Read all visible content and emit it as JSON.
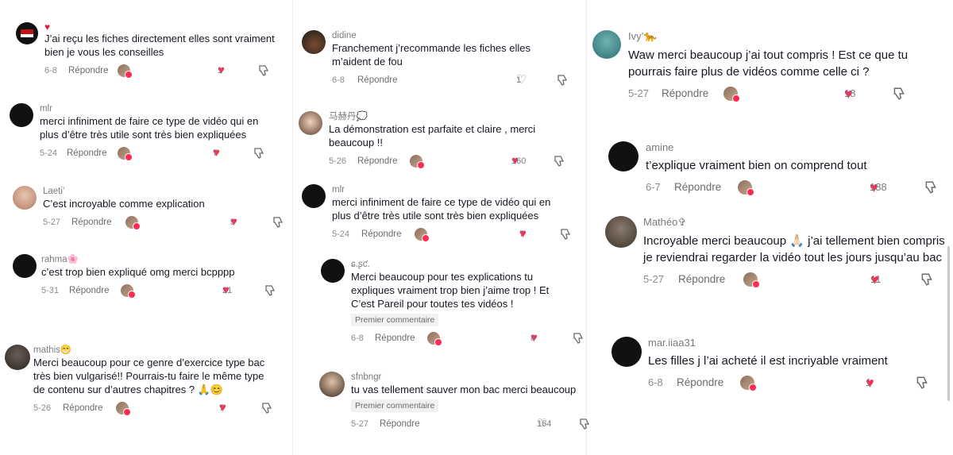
{
  "accent_color": "#fe2c55",
  "reply_label": "Répondre",
  "col1": [
    {
      "username": "",
      "text": "J’ai reçu les fiches directement elles sont vraiment bien je vous les conseilles",
      "date": "6-8",
      "likes": "1",
      "liked": true,
      "has_heart_badge": true
    },
    {
      "username": "mlr",
      "text": "merci infiniment de faire ce type de vidéo qui en plus d’être très utile sont très bien expliquées",
      "date": "5-24",
      "likes": "7",
      "liked": true
    },
    {
      "username": "Laeti’",
      "text": "C’est incroyable comme explication",
      "date": "5-27",
      "likes": "5",
      "liked": true
    },
    {
      "username": "rahma🌸",
      "text": "c’est trop bien expliqué omg merci bcpppp",
      "date": "5-31",
      "likes": "21",
      "liked": true
    },
    {
      "username": "mathis😁",
      "text": "Merci beaucoup pour ce genre d’exercice type bac très bien vulgarisé!! Pourrais-tu faire le même type de contenu sur d’autres chapitres ? 🙏😊",
      "date": "5-26",
      "likes": "7",
      "liked": true
    }
  ],
  "col2": [
    {
      "username": "didine",
      "text": "Franchement j’recommande les fiches elles m’aident de fou",
      "date": "6-8",
      "likes": "1",
      "liked": false
    },
    {
      "username": "马赫丹💭",
      "text": "La démonstration est parfaite et claire , merci beaucoup !!",
      "date": "5-26",
      "likes": "160",
      "liked": true
    },
    {
      "username": "mlr",
      "text": "merci infiniment de faire ce type de vidéo qui en plus d’être très utile sont très bien expliquées",
      "date": "5-24",
      "likes": "7",
      "liked": true
    },
    {
      "username": "ɕ.ʂƈ.",
      "text": "Merci beaucoup pour tes explications tu expliques vraiment trop bien j’aime trop ! Et C’est Pareil pour toutes tes vidéos !",
      "badge": "Premier commentaire",
      "date": "6-8",
      "likes": "8",
      "liked": true
    },
    {
      "username": "sfnbngr",
      "text": "tu vas tellement sauver mon bac merci beaucoup",
      "badge": "Premier commentaire",
      "date": "5-27",
      "likes": "164",
      "liked": false
    }
  ],
  "col3": [
    {
      "username": "Ivy’🐆",
      "text": "Waw merci beaucoup j’ai tout compris ! Est ce que tu pourrais faire plus de vidéos comme celle ci ?",
      "date": "5-27",
      "likes": "18",
      "liked": true
    },
    {
      "username": "amine",
      "text": "t’explique vraiment bien on comprend tout",
      "date": "6-7",
      "likes": "188",
      "liked": true
    },
    {
      "username": "Mathéo✞",
      "text": "Incroyable merci beaucoup 🙏🏻 j’ai tellement bien compris je reviendrai regarder la vidéo tout les jours jusqu’au bac",
      "date": "5-27",
      "likes": "11",
      "liked": true
    },
    {
      "username": "mar.iiaa31",
      "text": "Les filles j l’ai acheté il est incriyable vraiment",
      "date": "6-8",
      "likes": "1",
      "liked": true
    }
  ]
}
